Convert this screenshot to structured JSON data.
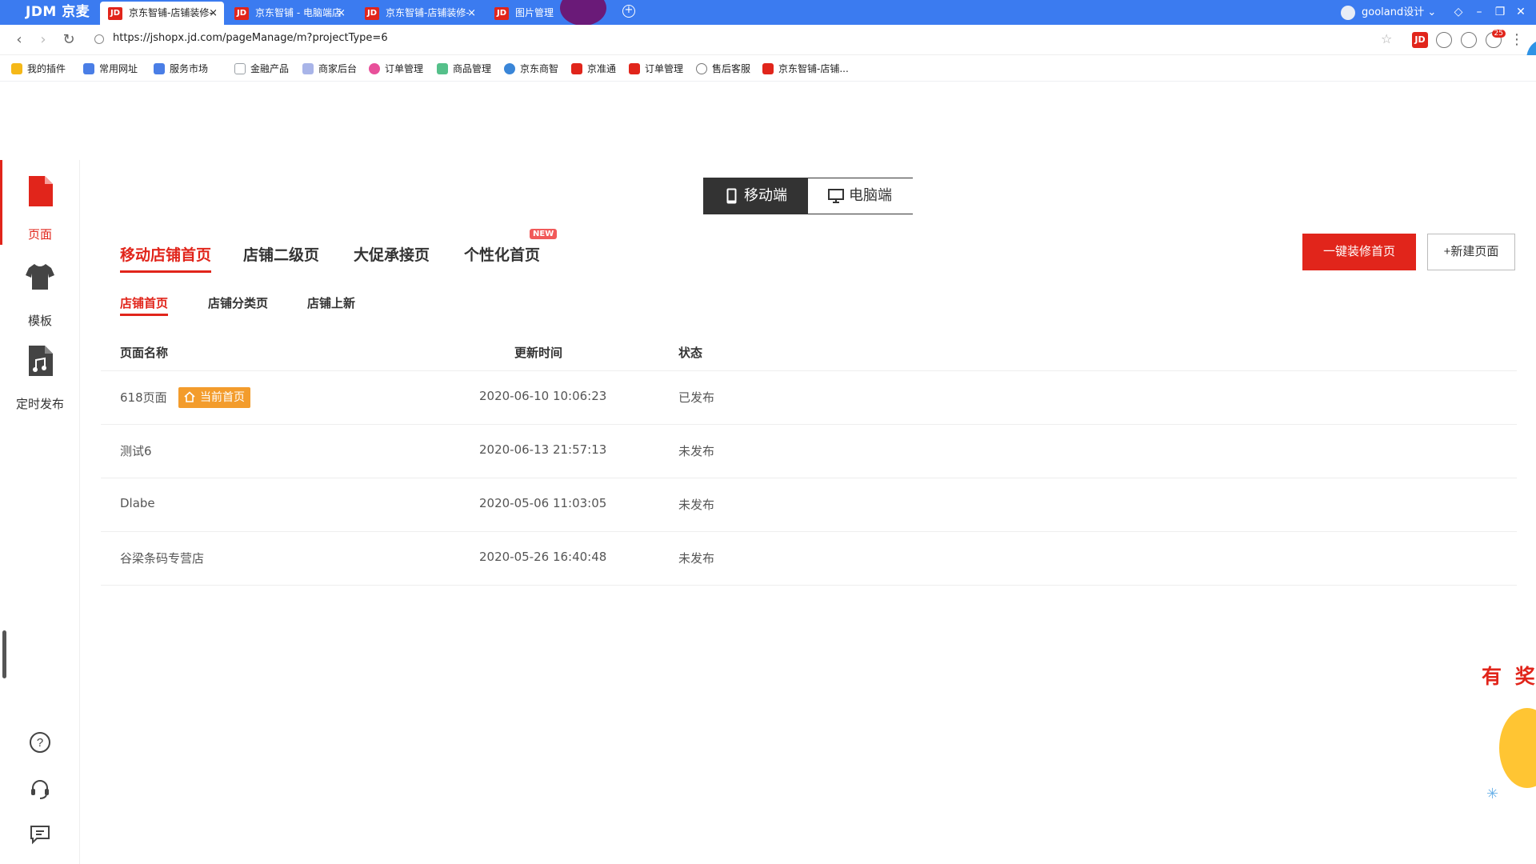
{
  "browser": {
    "brand": "JDM 京麦",
    "tabs": [
      {
        "label": "京东智铺-店铺装修-",
        "active": true
      },
      {
        "label": "京东智铺 - 电脑端店",
        "active": false
      },
      {
        "label": "京东智铺-店铺装修-",
        "active": false
      },
      {
        "label": "图片管理",
        "active": false
      }
    ],
    "tab_close": "×",
    "user": "gooland设计",
    "url": "https://jshopx.jd.com/pageManage/m?projectType=6",
    "notification_count": "25",
    "bookmarks": [
      {
        "label": "我的插件",
        "color": "#f5b818"
      },
      {
        "label": "常用网址",
        "color": "#4a7ee6"
      },
      {
        "label": "服务市场",
        "color": "#4a7ee6"
      },
      {
        "label": "金融产品",
        "color": "#9aa0a6"
      },
      {
        "label": "商家后台",
        "color": "#a8b4e8"
      },
      {
        "label": "订单管理",
        "color": "#e8509a"
      },
      {
        "label": "商品管理",
        "color": "#55c08a"
      },
      {
        "label": "京东商智",
        "color": "#3a86d8"
      },
      {
        "label": "京准通",
        "color": "#e1251b"
      },
      {
        "label": "订单管理",
        "color": "#e1251b"
      },
      {
        "label": "售后客服",
        "color": "#777777"
      },
      {
        "label": "京东智铺-店铺...",
        "color": "#e1251b"
      }
    ]
  },
  "sidebar": {
    "items": [
      {
        "label": "页面",
        "icon": "page-icon",
        "active": true
      },
      {
        "label": "模板",
        "icon": "shirt-icon",
        "active": false
      },
      {
        "label": "定时发布",
        "icon": "scheduled-doc-icon",
        "active": false
      }
    ],
    "bottom_icons": [
      "help-icon",
      "headset-icon",
      "feedback-icon"
    ]
  },
  "switcher": {
    "mobile": "移动端",
    "pc": "电脑端"
  },
  "main_tabs": [
    {
      "label": "移动店铺首页",
      "active": true
    },
    {
      "label": "店铺二级页",
      "active": false
    },
    {
      "label": "大促承接页",
      "active": false
    },
    {
      "label": "个性化首页",
      "active": false
    }
  ],
  "new_badge": "NEW",
  "actions": {
    "primary": "一键装修首页",
    "secondary": "+新建页面"
  },
  "sub_tabs": [
    {
      "label": "店铺首页",
      "active": true
    },
    {
      "label": "店铺分类页",
      "active": false
    },
    {
      "label": "店铺上新",
      "active": false
    }
  ],
  "table": {
    "headers": {
      "name": "页面名称",
      "updated": "更新时间",
      "status": "状态"
    },
    "current_tag": "当前首页",
    "rows": [
      {
        "name": "618页面",
        "updated": "2020-06-10 10:06:23",
        "status": "已发布"
      },
      {
        "name": "测试6",
        "updated": "2020-06-13 21:57:13",
        "status": "未发布"
      },
      {
        "name": "Dlabe",
        "updated": "2020-05-06 11:03:05",
        "status": "未发布"
      },
      {
        "name": "谷梁条码专营店",
        "updated": "2020-05-26 16:40:48",
        "status": "未发布"
      }
    ]
  },
  "promo": {
    "text": "有 奖"
  },
  "colors": {
    "accent": "#e1251b",
    "chrome": "#3b7bf0",
    "tag": "#f39c2c"
  }
}
